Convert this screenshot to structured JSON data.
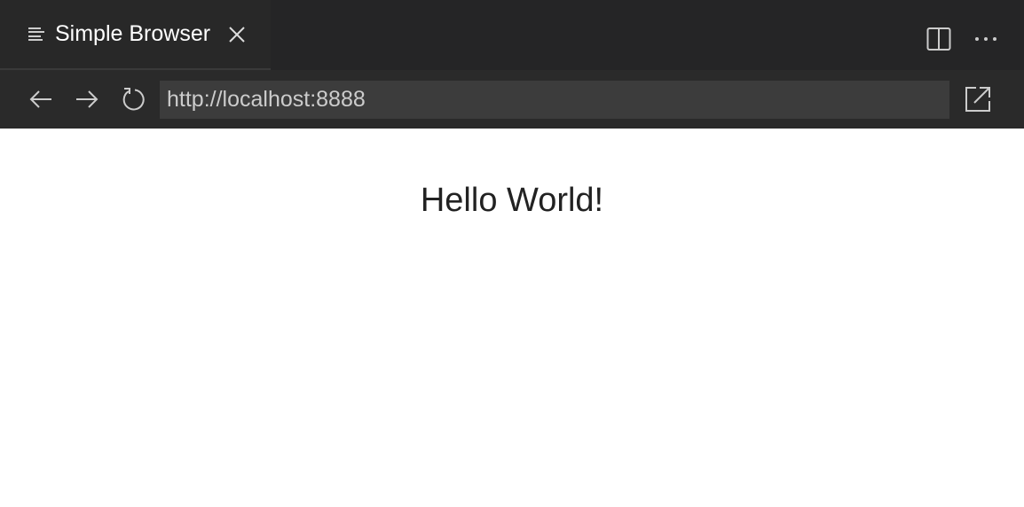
{
  "tab": {
    "title": "Simple Browser",
    "icon": "preview-lines-icon"
  },
  "toolbar": {
    "url": "http://localhost:8888"
  },
  "page": {
    "heading": "Hello World!"
  },
  "colors": {
    "tabbar": "#252526",
    "toolbar": "#2a2a2a",
    "url_bg": "#3c3c3c"
  }
}
